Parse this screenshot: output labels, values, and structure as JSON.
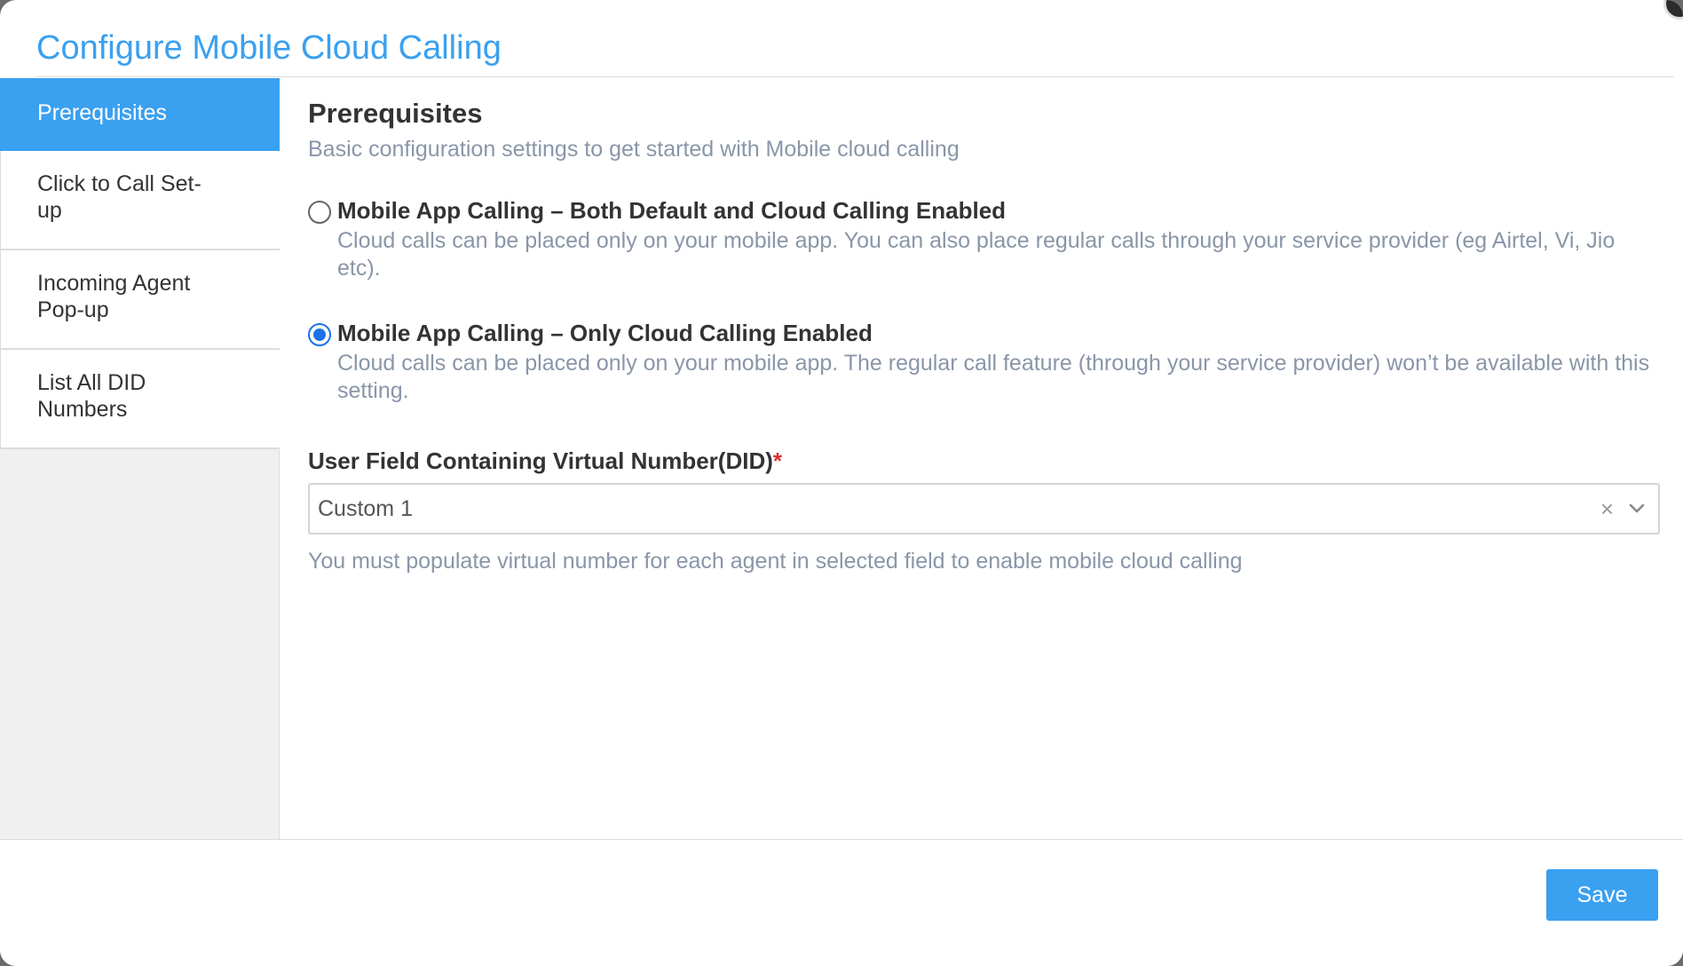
{
  "header": {
    "title": "Configure Mobile Cloud Calling"
  },
  "sidebar": {
    "items": [
      {
        "label": "Prerequisites",
        "active": true
      },
      {
        "label": "Click to Call Set-up",
        "active": false
      },
      {
        "label": "Incoming Agent Pop-up",
        "active": false
      },
      {
        "label": "List All DID Numbers",
        "active": false
      }
    ]
  },
  "main": {
    "title": "Prerequisites",
    "subtitle": "Basic configuration settings to get started with Mobile cloud calling",
    "options": [
      {
        "label": "Mobile App Calling – Both Default and Cloud Calling Enabled",
        "description": "Cloud calls can be placed only on your mobile app. You can also place regular calls through your service provider (eg Airtel, Vi, Jio etc).",
        "selected": false
      },
      {
        "label": "Mobile App Calling – Only Cloud Calling Enabled",
        "description": "Cloud calls can be placed only on your mobile app. The regular call feature (through your service provider) won’t be available with this setting.",
        "selected": true
      }
    ],
    "field": {
      "label": "User Field Containing Virtual Number(DID)",
      "required_mark": "*",
      "value": "Custom 1",
      "clear_glyph": "×",
      "helper": "You must populate virtual number for each agent in selected field to enable mobile cloud calling"
    }
  },
  "footer": {
    "save_label": "Save"
  },
  "colors": {
    "accent": "#3aa0f0",
    "radio_selected": "#1a73e8",
    "required": "#d32f2f",
    "muted_text": "#8a96a8"
  },
  "icons": {
    "chevron": "chevron-down-icon",
    "clear": "close-icon"
  }
}
